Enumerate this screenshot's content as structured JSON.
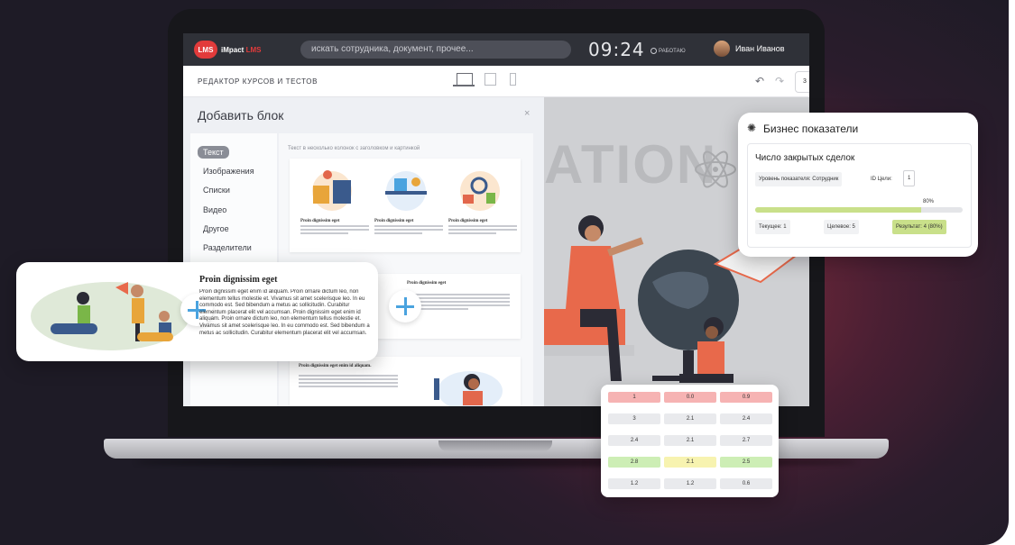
{
  "app": {
    "logo_badge": "LMS",
    "logo_name": "iMpact",
    "logo_suffix": "LMS",
    "search_placeholder": "искать сотрудника, документ, прочее...",
    "clock": "09:24",
    "status": "РАБОТАЮ",
    "user_name": "Иван Иванов"
  },
  "editor": {
    "title": "РЕДАКТОР КУРСОВ И ТЕСТОВ",
    "more_label": "3"
  },
  "add_block": {
    "title": "Добавить блок",
    "close": "×",
    "categories": [
      "Текст",
      "Изображения",
      "Списки",
      "Видео",
      "Другое",
      "Разделители"
    ],
    "tile_caption": "Текст в несколько колонок с заголовком и картинкой",
    "mini_heading": "Proin dignissim eget",
    "card_heading": "Proin dignissim eget",
    "card_body": "Proin dignissim eget enim id aliquam. Proin ornare dictum leo, non elementum tellus molestie et. Vivamus sit amet scelerisque leo. In eu commodo est. Sed bibendum a metus ac sollicitudin. Curabitur elementum placerat elit vel accumsan. Proin dignissim eget enim id aliquam. Proin ornare dictum leo, non elementum tellus molestie et. Vivamus sit amet scelerisque leo. In eu commodo est. Sed bibendum a metus ac sollicitudin. Curabitur elementum placerat elit vel accumsan.",
    "bottom_heading": "Proin dignissim eget enim id aliquam."
  },
  "canvas": {
    "big_word": "ATION"
  },
  "kpi": {
    "title": "Бизнес показатели",
    "subtitle": "Число закрытых сделок",
    "level_label": "Уровень показателя: Сотрудник",
    "goal_id_label": "ID Цели:",
    "goal_id": "1",
    "progress_percent": 80,
    "progress_label": "80%",
    "current": "Текущее: 1",
    "target": "Целевое: 5",
    "result": "Результат: 4 (80%)",
    "accent_color": "#c9e08a"
  },
  "number_table": {
    "rows": [
      [
        "1",
        "0.0",
        "0.9"
      ],
      [
        "3",
        "2.1",
        "2.4"
      ],
      [
        "2.4",
        "2.1",
        "2.7"
      ],
      [
        "2.8",
        "2.1",
        "2.5"
      ],
      [
        "1.2",
        "1.2",
        "0.6"
      ]
    ],
    "colors": {
      "red": "#f6b3b3",
      "yellow": "#f7f3b0",
      "green": "#cdeeb5",
      "grey": "#e9eaed"
    }
  }
}
